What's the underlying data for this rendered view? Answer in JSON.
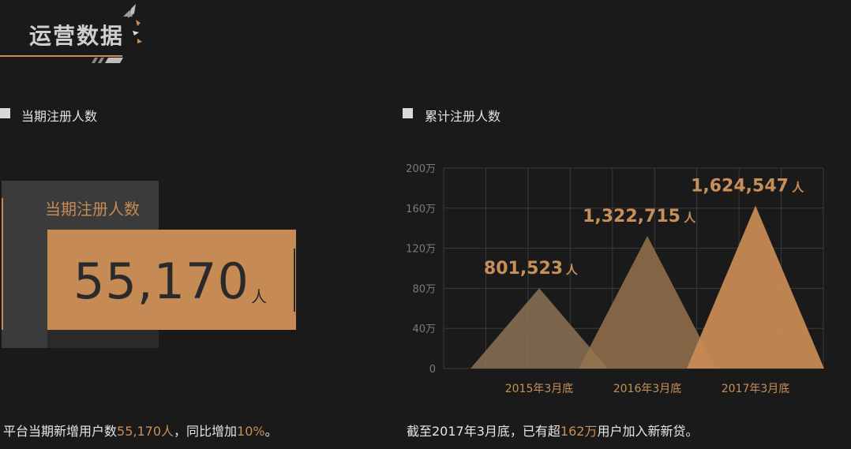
{
  "header": {
    "title": "运营数据"
  },
  "left": {
    "section_label": "当期注册人数",
    "card_caption": "当期注册人数",
    "card_value": "55,170",
    "card_unit": "人",
    "footer": {
      "prefix": "平台当期新增用户数",
      "value": "55,170人",
      "mid": "，同比增加",
      "pct": "10%",
      "suffix": "。"
    }
  },
  "right": {
    "section_label": "累计注册人数",
    "footer": {
      "prefix": "截至2017年3月底，已有超",
      "value": "162万",
      "suffix": "用户加入新新贷。"
    }
  },
  "colors": {
    "accent": "#c88f58",
    "background": "#1a1a1a",
    "panel": "#3b3b3b",
    "tri1": "#8c7255",
    "tri2": "#97734f",
    "tri3": "#c68a54"
  },
  "chart_data": {
    "type": "area",
    "categories": [
      "2015年3月底",
      "2016年3月底",
      "2017年3月底"
    ],
    "values": [
      801523,
      1322715,
      1624547
    ],
    "data_labels": [
      "801,523",
      "1,322,715",
      "1,624,547"
    ],
    "data_unit": "人",
    "y_ticks": [
      "0",
      "40万",
      "80万",
      "120万",
      "160万",
      "200万"
    ],
    "ylim": [
      0,
      2000000
    ],
    "grid": true
  }
}
